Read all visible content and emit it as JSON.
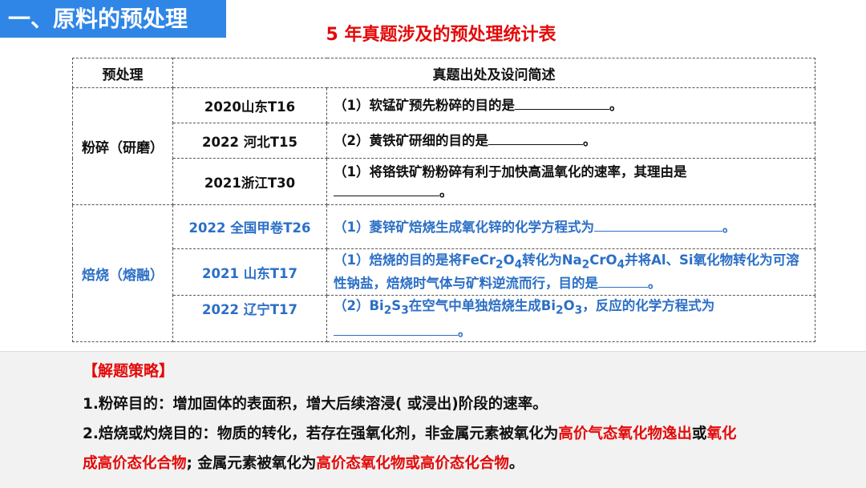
{
  "header": {
    "section_title": "一、原料的预处理",
    "table_title": "5 年真题涉及的预处理统计表"
  },
  "table": {
    "col1_header": "预处理",
    "col2_header": "真题出处及设问简述",
    "groups": [
      {
        "category": "粉碎（研磨）",
        "rows": [
          {
            "source": "2020山东T16",
            "text": "（1）软锰矿预先粉碎的目的是",
            "end": "。"
          },
          {
            "source": "2022 河北T15",
            "text": "（2）黄铁矿研细的目的是",
            "end": "。"
          },
          {
            "source": "2021浙江T30",
            "text": "（1）将铬铁矿粉粉碎有利于加快高温氧化的速率，其理由是",
            "end": "。"
          }
        ]
      },
      {
        "category": "焙烧（熔融）",
        "rows": [
          {
            "source": "2022 全国甲卷T26",
            "text": "（1）菱锌矿焙烧生成氧化锌的化学方程式为",
            "end": "。"
          },
          {
            "source": "2021 山东T17",
            "text_a": "（1）焙烧的目的是将FeCr",
            "sub1": "2",
            "text_b": "O",
            "sub2": "4",
            "text_c": "转化为Na",
            "sub3": "2",
            "text_d": "CrO",
            "sub4": "4",
            "text_e": "并将Al、Si氧化物转化为可溶性钠盐，焙烧时气体与矿料逆流而行，目的是",
            "end": "。"
          },
          {
            "source": "2022 辽宁T17",
            "text_a": "（2）Bi",
            "sub1": "2",
            "text_b": "S",
            "sub2": "3",
            "text_c": "在空气中单独焙烧生成Bi",
            "sub3": "2",
            "text_d": "O",
            "sub4": "3",
            "text_e": "，反应的化学方程式为",
            "end": "。"
          }
        ]
      }
    ]
  },
  "strategy": {
    "title": "【解题策略】",
    "line1": "1.粉碎目的：增加固体的表面积，增大后续溶浸( 或浸出)阶段的速率。",
    "line2_a": "2.焙烧或灼烧目的：物质的转化，若存在强氧化剂，非金属元素被氧化为",
    "line2_red1": "高价气态氧化物逸出",
    "line2_b": "或",
    "line2_red2": "氧化",
    "line3_red1": "成高价态化合物",
    "line3_a": "; 金属元素被氧化为",
    "line3_red2": "高价态氧化物或高价态化合物",
    "line3_b": "。"
  },
  "colors": {
    "accent_blue": "#2f86e6",
    "red": "#e30a0a",
    "row_blue": "#2b6fc6"
  }
}
